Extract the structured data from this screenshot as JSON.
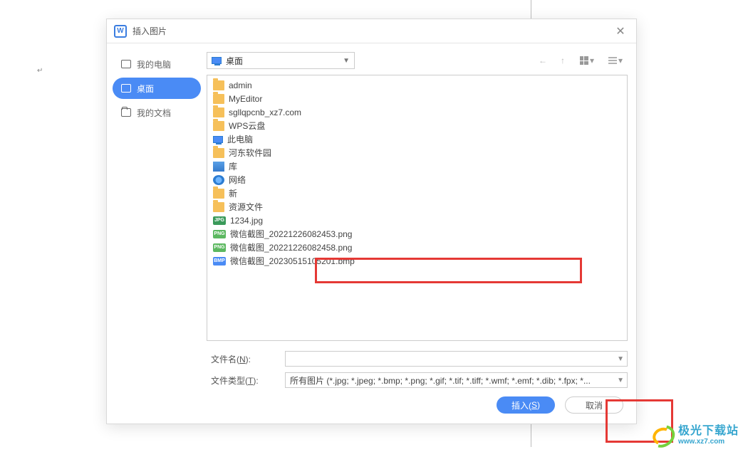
{
  "dialog": {
    "title": "插入图片",
    "close_glyph": "✕"
  },
  "sidebar": {
    "items": [
      {
        "label": "我的电脑"
      },
      {
        "label": "桌面"
      },
      {
        "label": "我的文档"
      }
    ]
  },
  "toolbar": {
    "path": "桌面",
    "back_glyph": "←",
    "up_glyph": "↑",
    "view_arrow": "▾"
  },
  "files": [
    {
      "type": "folder",
      "name": "admin"
    },
    {
      "type": "folder",
      "name": "MyEditor"
    },
    {
      "type": "folder",
      "name": "sgllqpcnb_xz7.com"
    },
    {
      "type": "folder",
      "name": "WPS云盘"
    },
    {
      "type": "monitor",
      "name": "此电脑"
    },
    {
      "type": "folder",
      "name": "河东软件园"
    },
    {
      "type": "lib",
      "name": "库"
    },
    {
      "type": "net",
      "name": "网络"
    },
    {
      "type": "folder",
      "name": "新"
    },
    {
      "type": "folder",
      "name": "资源文件"
    },
    {
      "type": "jpg",
      "name": "1234.jpg",
      "badge": "JPG"
    },
    {
      "type": "png",
      "name": "微信截图_20221226082453.png",
      "badge": "PNG"
    },
    {
      "type": "png",
      "name": "微信截图_20221226082458.png",
      "badge": "PNG"
    },
    {
      "type": "bmp",
      "name": "微信截图_20230515105201.bmp",
      "badge": "BMP"
    }
  ],
  "form": {
    "name_label": "文件名(N):",
    "name_value": "",
    "type_label": "文件类型(T):",
    "type_value": "所有图片 (*.jpg; *.jpeg; *.bmp; *.png; *.gif; *.tif; *.tiff; *.wmf; *.emf; *.dib; *.fpx; *..."
  },
  "buttons": {
    "insert": "插入(S)",
    "cancel": "取消"
  },
  "watermark": {
    "text": "极光下载站",
    "url": "www.xz7.com"
  },
  "doc_mark": "↵"
}
